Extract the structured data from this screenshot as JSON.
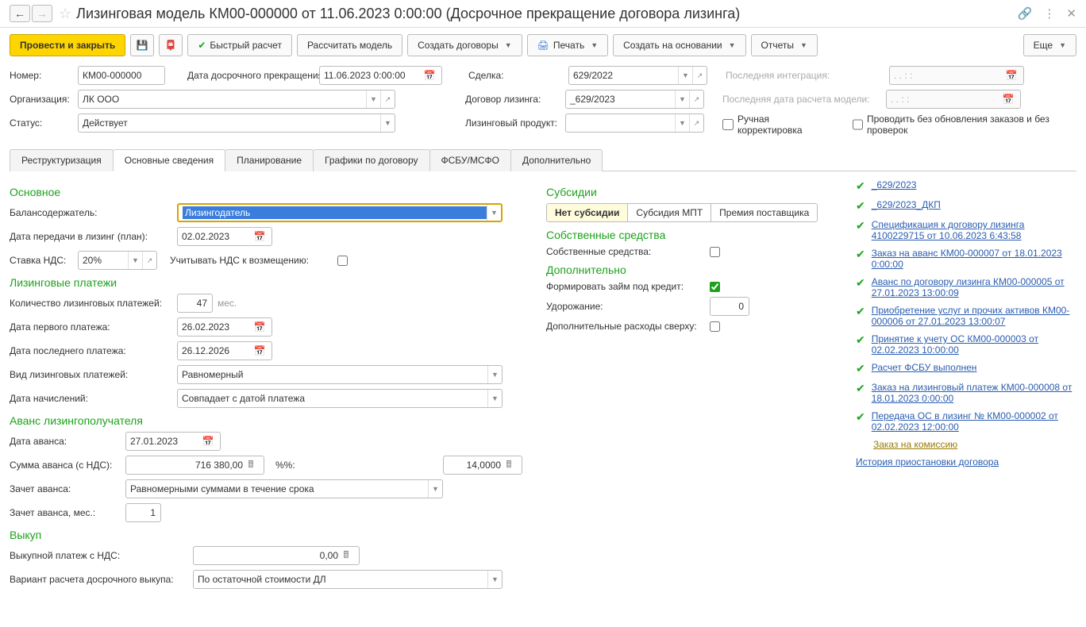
{
  "title": "Лизинговая модель КМ00-000000 от 11.06.2023 0:00:00 (Досрочное прекращение договора лизинга)",
  "toolbar": {
    "post_close": "Провести и закрыть",
    "quick_calc": "Быстрый расчет",
    "calc_model": "Рассчитать модель",
    "create_contracts": "Создать договоры",
    "print": "Печать",
    "create_based": "Создать на основании",
    "reports": "Отчеты",
    "more": "Еще"
  },
  "form": {
    "number_lbl": "Номер:",
    "number": "КМ00-000000",
    "term_date_lbl": "Дата досрочного прекращения:",
    "term_date": "11.06.2023  0:00:00",
    "deal_lbl": "Сделка:",
    "deal": "629/2022",
    "last_int_lbl": "Последняя интеграция:",
    "last_int": "  .  .       :  :",
    "org_lbl": "Организация:",
    "org": "ЛК ООО",
    "contract_lbl": "Договор лизинга:",
    "contract": "_629/2023",
    "last_calc_lbl": "Последняя дата расчета модели:",
    "last_calc": "  .  .       :  :",
    "status_lbl": "Статус:",
    "status": "Действует",
    "product_lbl": "Лизинговый продукт:",
    "product": "",
    "manual_lbl": "Ручная корректировка",
    "nochk_lbl": "Проводить без обновления заказов и без проверок"
  },
  "tabs": [
    "Реструктуризация",
    "Основные сведения",
    "Планирование",
    "Графики по договору",
    "ФСБУ/МСФО",
    "Дополнительно"
  ],
  "main": {
    "basic_hdr": "Основное",
    "balance_lbl": "Балансодержатель:",
    "balance": "Лизингодатель",
    "transfer_lbl": "Дата передачи в лизинг (план):",
    "transfer": "02.02.2023",
    "vat_lbl": "Ставка НДС:",
    "vat": "20%",
    "vat_chk_lbl": "Учитывать НДС к возмещению:",
    "pay_hdr": "Лизинговые платежи",
    "count_lbl": "Количество лизинговых платежей:",
    "count": "47",
    "count_unit": "мес.",
    "first_lbl": "Дата первого платежа:",
    "first": "26.02.2023",
    "last_lbl": "Дата последнего платежа:",
    "last": "26.12.2026",
    "kind_lbl": "Вид лизинговых платежей:",
    "kind": "Равномерный",
    "accr_lbl": "Дата начислений:",
    "accr": "Совпадает с датой платежа",
    "adv_hdr": "Аванс лизингополучателя",
    "adv_date_lbl": "Дата аванса:",
    "adv_date": "27.01.2023",
    "adv_sum_lbl": "Сумма аванса (с НДС):",
    "adv_sum": "716 380,00",
    "adv_pct_lbl": "%%:",
    "adv_pct": "14,0000",
    "adv_off_lbl": "Зачет аванса:",
    "adv_off": "Равномерными суммами в течение срока",
    "adv_mon_lbl": "Зачет аванса, мес.:",
    "adv_mon": "1",
    "buy_hdr": "Выкуп",
    "buy_sum_lbl": "Выкупной платеж с НДС:",
    "buy_sum": "0,00",
    "buy_var_lbl": "Вариант расчета досрочного выкупа:",
    "buy_var": "По остаточной стоимости ДЛ"
  },
  "mid": {
    "sub_hdr": "Субсидии",
    "sub_opts": [
      "Нет субсидии",
      "Субсидия МПТ",
      "Премия поставщика"
    ],
    "own_hdr": "Собственные средства",
    "own_lbl": "Собственные средства:",
    "extra_hdr": "Дополнительно",
    "loan_lbl": "Формировать займ под кредит:",
    "appr_lbl": "Удорожание:",
    "appr": "0",
    "top_lbl": "Дополнительные расходы сверху:"
  },
  "links": [
    "_629/2023",
    "_629/2023_ДКП",
    "Спецификация к договору лизинга 4100229715 от 10.06.2023 6:43:58",
    "Заказ на аванс КМ00-000007 от 18.01.2023 0:00:00",
    "Аванс по договору лизинга КМ00-000005 от 27.01.2023 13:00:09",
    "Приобретение услуг и прочих активов КМ00-000006 от 27.01.2023 13:00:07",
    "Принятие к учету ОС КМ00-000003 от 02.02.2023 10:00:00",
    "Расчет ФСБУ выполнен",
    "Заказ на лизинговый платеж КМ00-000008 от 18.01.2023 0:00:00",
    "Передача ОС в лизинг № КМ00-000002 от 02.02.2023 12:00:00"
  ],
  "extra_link": "Заказ на комиссию",
  "history_link": "История приостановки договора"
}
